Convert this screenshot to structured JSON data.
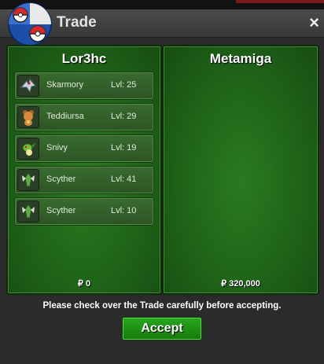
{
  "window": {
    "title": "Trade",
    "close_label": "×"
  },
  "left_panel": {
    "player_name": "Lor3hc",
    "money": "₽ 0",
    "pokemon": [
      {
        "name": "Skarmory",
        "level": "Lvl: 25",
        "icon": "skarmory-icon",
        "color": "#c8d0dc"
      },
      {
        "name": "Teddiursa",
        "level": "Lvl: 29",
        "icon": "teddiursa-icon",
        "color": "#d8893a"
      },
      {
        "name": "Snivy",
        "level": "Lvl: 19",
        "icon": "snivy-icon",
        "color": "#6fbf3a"
      },
      {
        "name": "Scyther",
        "level": "Lvl: 41",
        "icon": "scyther-icon",
        "color": "#5fa84a"
      },
      {
        "name": "Scyther",
        "level": "Lvl: 10",
        "icon": "scyther-icon",
        "color": "#5fa84a"
      }
    ]
  },
  "right_panel": {
    "player_name": "Metamiga",
    "money": "₽ 320,000"
  },
  "notice": "Please check over the Trade carefully before accepting.",
  "accept_label": "Accept",
  "colors": {
    "panel_green": "#1f6318",
    "accept_green": "#22961a",
    "titlebar": "#404040"
  }
}
